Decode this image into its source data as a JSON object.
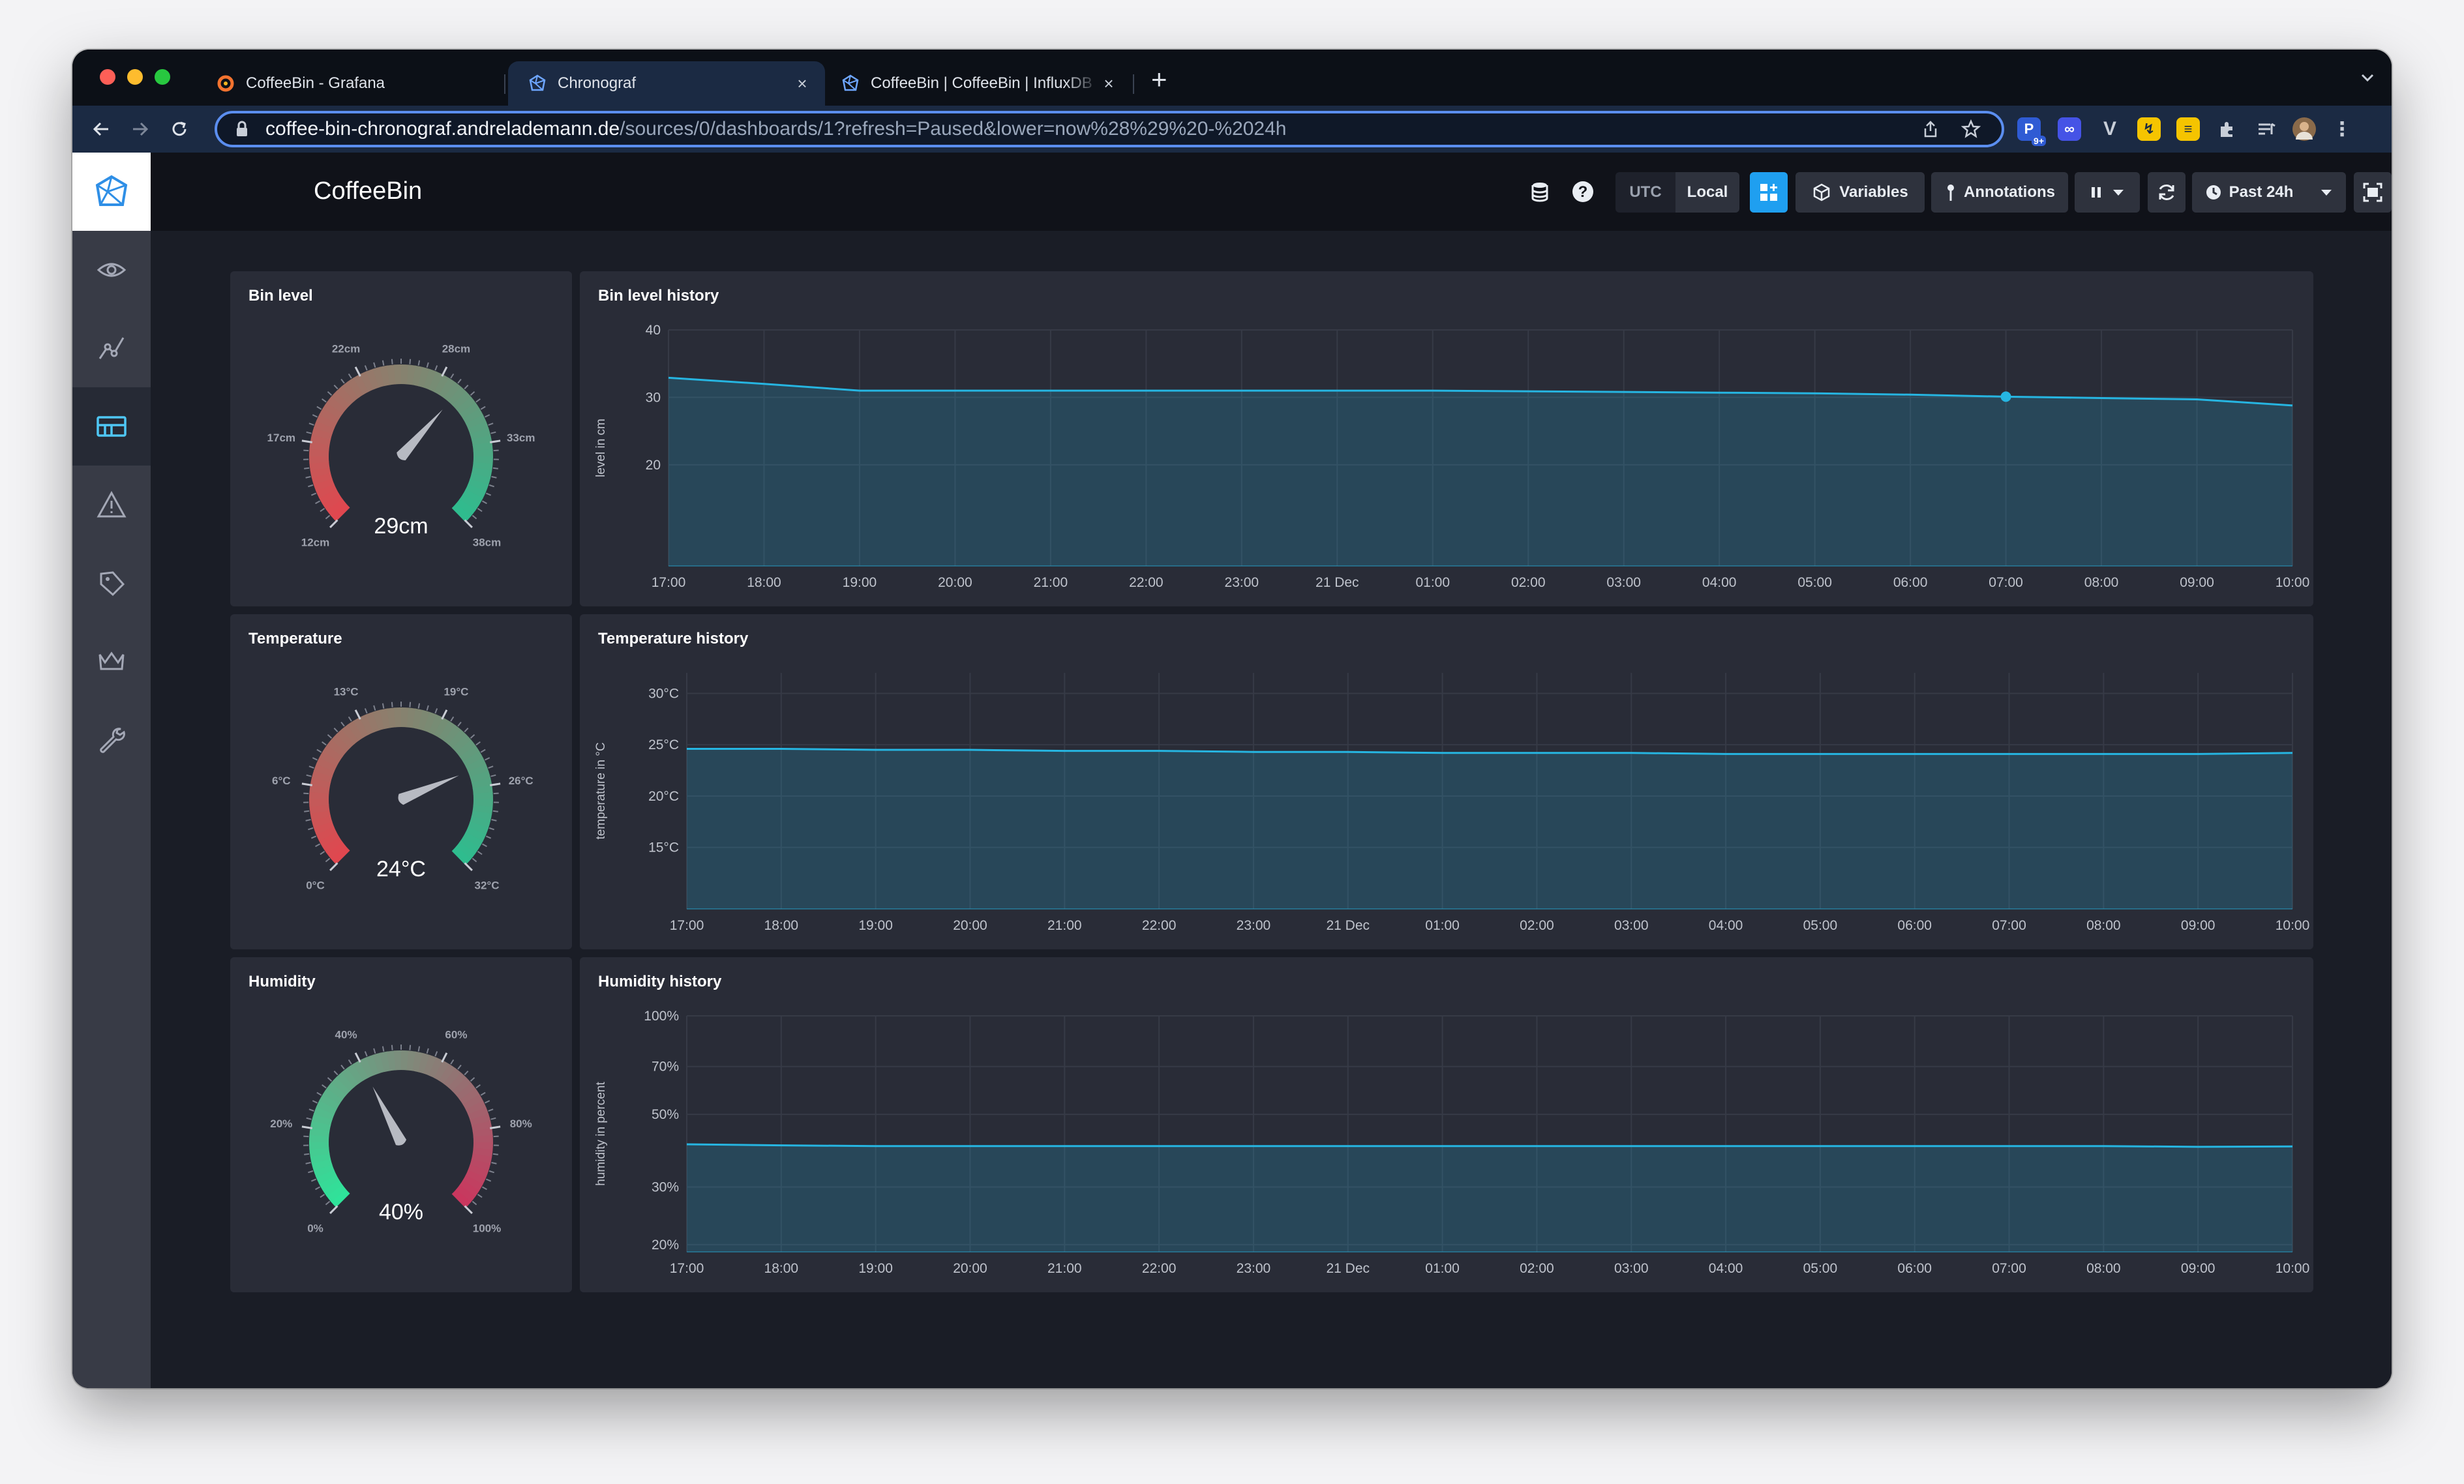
{
  "browser": {
    "tabs": [
      {
        "title": "CoffeeBin - Grafana",
        "close": "×"
      },
      {
        "title": "Chronograf",
        "close": "×"
      },
      {
        "title": "CoffeeBin | CoffeeBin | InfluxDB",
        "close": "×"
      }
    ],
    "new_tab": "+",
    "url_host": "coffee-bin-chronograf.andrelademann.de",
    "url_path": "/sources/0/dashboards/1?refresh=Paused&lower=now%28%29%20-%2024h",
    "extension_badge": "9+"
  },
  "header": {
    "title": "CoffeeBin",
    "tz_utc": "UTC",
    "tz_local": "Local",
    "variables": "Variables",
    "annotations": "Annotations",
    "time_range": "Past 24h"
  },
  "time_ticks": [
    "17:00",
    "18:00",
    "19:00",
    "20:00",
    "21:00",
    "22:00",
    "23:00",
    "21 Dec",
    "01:00",
    "02:00",
    "03:00",
    "04:00",
    "05:00",
    "06:00",
    "07:00",
    "08:00",
    "09:00",
    "10:00"
  ],
  "gauges": [
    {
      "title": "Bin level",
      "value": 29,
      "display": "29cm",
      "min": 12,
      "max": 38,
      "labels": [
        "12cm",
        "17cm",
        "22cm",
        "28cm",
        "33cm",
        "38cm"
      ],
      "colors": [
        "#e0474f",
        "#2fbc8e"
      ]
    },
    {
      "title": "Temperature",
      "value": 24,
      "display": "24°C",
      "min": 0,
      "max": 32,
      "labels": [
        "0°C",
        "6°C",
        "13°C",
        "19°C",
        "26°C",
        "32°C"
      ],
      "colors": [
        "#e0474f",
        "#2fbc8e"
      ]
    },
    {
      "title": "Humidity",
      "value": 40,
      "display": "40%",
      "min": 0,
      "max": 100,
      "labels": [
        "0%",
        "20%",
        "40%",
        "60%",
        "80%",
        "100%"
      ],
      "colors": [
        "#2fe39a",
        "#c9375e"
      ]
    }
  ],
  "chart_data": [
    {
      "type": "area",
      "title": "Bin level history",
      "ylabel": "level in cm",
      "yticks": [
        "20",
        "30",
        "40"
      ],
      "ylim": [
        5,
        40
      ],
      "x": [
        "17:00",
        "18:00",
        "19:00",
        "20:00",
        "21:00",
        "22:00",
        "23:00",
        "21 Dec",
        "01:00",
        "02:00",
        "03:00",
        "04:00",
        "05:00",
        "06:00",
        "07:00",
        "08:00",
        "09:00",
        "10:00"
      ],
      "series": [
        {
          "values": [
            32.9,
            32.0,
            31.0,
            31.0,
            31.0,
            31.0,
            31.0,
            31.0,
            31.0,
            30.9,
            30.8,
            30.7,
            30.6,
            30.4,
            30.1,
            29.9,
            29.7,
            28.8
          ]
        }
      ],
      "highlight": {
        "x": "07:00",
        "y": 30.1
      },
      "color": "#26b5e1"
    },
    {
      "type": "area",
      "title": "Temperature history",
      "ylabel": "temperature in °C",
      "yticks": [
        "15°C",
        "20°C",
        "25°C",
        "30°C"
      ],
      "ylim": [
        9,
        32
      ],
      "x": [
        "17:00",
        "18:00",
        "19:00",
        "20:00",
        "21:00",
        "22:00",
        "23:00",
        "21 Dec",
        "01:00",
        "02:00",
        "03:00",
        "04:00",
        "05:00",
        "06:00",
        "07:00",
        "08:00",
        "09:00",
        "10:00"
      ],
      "series": [
        {
          "values": [
            24.6,
            24.6,
            24.5,
            24.5,
            24.4,
            24.4,
            24.3,
            24.3,
            24.2,
            24.2,
            24.2,
            24.1,
            24.1,
            24.1,
            24.1,
            24.1,
            24.1,
            24.2
          ]
        }
      ],
      "color": "#26b5e1"
    },
    {
      "type": "area",
      "title": "Humidity history",
      "ylabel": "humidity in percent",
      "yticks": [
        "20%",
        "30%",
        "50%",
        "70%",
        "100%"
      ],
      "yscale": "log",
      "ylim": [
        19,
        100
      ],
      "x": [
        "17:00",
        "18:00",
        "19:00",
        "20:00",
        "21:00",
        "22:00",
        "23:00",
        "21 Dec",
        "01:00",
        "02:00",
        "03:00",
        "04:00",
        "05:00",
        "06:00",
        "07:00",
        "08:00",
        "09:00",
        "10:00"
      ],
      "series": [
        {
          "values": [
            40.5,
            40.2,
            40.0,
            40.0,
            40.0,
            40.0,
            40.0,
            40.0,
            40.0,
            40.0,
            40.0,
            40.0,
            40.0,
            40.0,
            40.0,
            40.0,
            39.8,
            39.9
          ]
        }
      ],
      "color": "#26b5e1"
    }
  ]
}
